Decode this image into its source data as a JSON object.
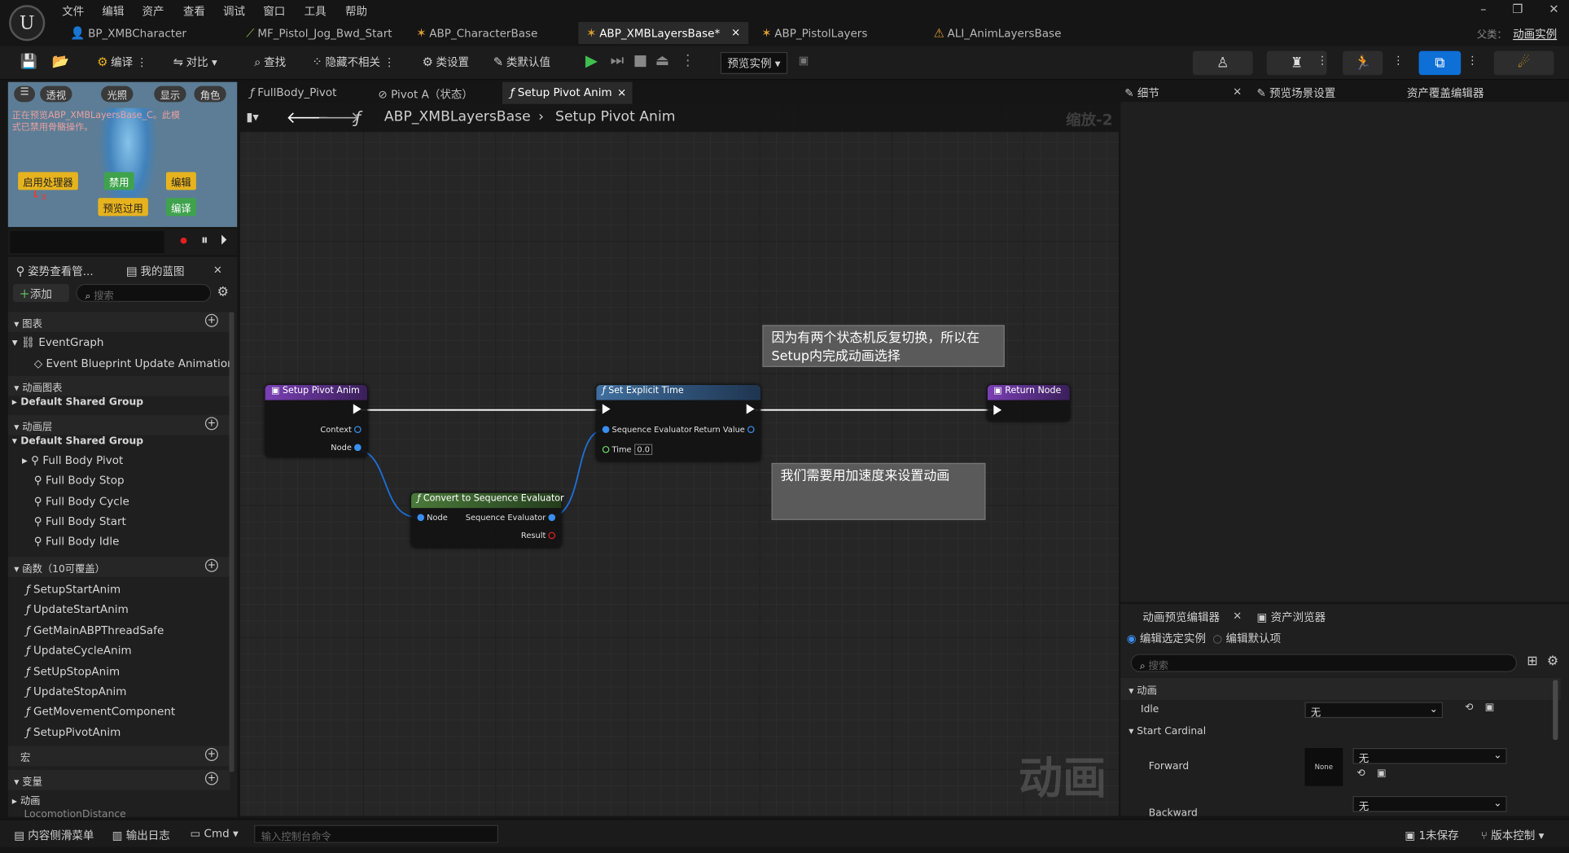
{
  "menu": [
    "文件",
    "编辑",
    "资产",
    "查看",
    "调试",
    "窗口",
    "工具",
    "帮助"
  ],
  "logo": "U",
  "window_controls": {
    "min": "–",
    "max": "❐",
    "close": "✕"
  },
  "doc_tabs": [
    "BP_XMBCharacter",
    "MF_Pistol_Jog_Bwd_Start",
    "ABP_CharacterBase",
    "ABP_XMBLayersBase*",
    "ABP_PistolLayers",
    "ALI_AnimLayersBase"
  ],
  "doc_tab_close": "×",
  "parent_label": "父类：",
  "parent_value": "动画实例",
  "toolbar": {
    "compile": "编译",
    "diff": "对比",
    "find": "查找",
    "hide_unrelated": "隐藏不相关",
    "class_settings": "类设置",
    "class_defaults": "类默认值",
    "preview_instance": "预览实例"
  },
  "viewport": {
    "pills": [
      "透视",
      "光照",
      "显示",
      "角色"
    ],
    "warning": "正在预览ABP_XMBLayersBase_C。此模式已禁用骨骼操作。",
    "btn_postprocess": "启用处理器",
    "btn_disable": "禁用",
    "btn_edit": "编辑",
    "btn_preview_filter": "预览过用",
    "btn_compile": "编译"
  },
  "left_tabs": {
    "pose_watch": "姿势查看管...",
    "my_blueprint": "我的蓝图",
    "close": "×"
  },
  "add_label": "添加",
  "search_placeholder": "搜索",
  "sections": {
    "graphs": "图表",
    "anim_graphs": "动画图表",
    "anim_layers": "动画层",
    "functions": "函数（10可覆盖）",
    "macros": "宏",
    "variables": "变量"
  },
  "graphs": {
    "event_graph": "EventGraph",
    "event_update": "Event Blueprint Update Animation"
  },
  "anim_graph_group": "Default Shared Group",
  "layer_group": "Default Shared Group",
  "layers": [
    "Full Body Pivot",
    "Full Body Stop",
    "Full Body Cycle",
    "Full Body Start",
    "Full Body Idle"
  ],
  "functions": [
    "SetupStartAnim",
    "UpdateStartAnim",
    "GetMainABPThreadSafe",
    "UpdateCycleAnim",
    "SetUpStopAnim",
    "UpdateStopAnim",
    "GetMovementComponent",
    "SetupPivotAnim"
  ],
  "var_cat": "动画",
  "var_partial": "LocomotionDistance",
  "graph_tabs": [
    "FullBody_Pivot",
    "Pivot A（状态）",
    "Setup Pivot Anim"
  ],
  "breadcrumb": {
    "root": "ABP_XMBLayersBase",
    "sep": "›",
    "leaf": "Setup Pivot Anim"
  },
  "zoom": "缩放-2",
  "watermark": "动画",
  "nodes": {
    "setup": {
      "title": "Setup Pivot Anim",
      "pins": [
        "Context",
        "Node"
      ]
    },
    "set_time": {
      "title": "Set Explicit Time",
      "pins": [
        "Sequence Evaluator",
        "Return Value",
        "Time"
      ],
      "time_value": "0.0"
    },
    "ret": {
      "title": "Return Node"
    },
    "convert": {
      "title": "Convert to Sequence Evaluator",
      "pins": [
        "Node",
        "Sequence Evaluator",
        "Result"
      ]
    }
  },
  "comments": {
    "c1": "因为有两个状态机反复切换，所以在Setup内完成动画选择",
    "c2": "我们需要用加速度来设置动画"
  },
  "right_tabs": {
    "details": "细节",
    "preview_scene": "预览场景设置",
    "asset_override": "资产覆盖编辑器"
  },
  "anim_preview": {
    "tab1": "动画预览编辑器",
    "tab2": "资产浏览器",
    "radio1": "编辑选定实例",
    "radio2": "编辑默认项",
    "search": "搜索",
    "section": "动画",
    "idle": "Idle",
    "none_cn": "无",
    "start_cardinal": "Start Cardinal",
    "forward": "Forward",
    "backward": "Backward",
    "thumb_none": "None"
  },
  "status": {
    "content_drawer": "内容侧滑菜单",
    "output_log": "输出日志",
    "cmd": "Cmd",
    "cmd_placeholder": "输入控制台命令",
    "unsaved": "1未保存",
    "source_control": "版本控制"
  },
  "colors": {
    "accent_blue": "#0e6fd6",
    "function_header": "#6a3fa0",
    "green_header": "#4a7a3a",
    "setexplicit_header": "#2f5f8f",
    "comment_bg": "#5a5a5a"
  }
}
